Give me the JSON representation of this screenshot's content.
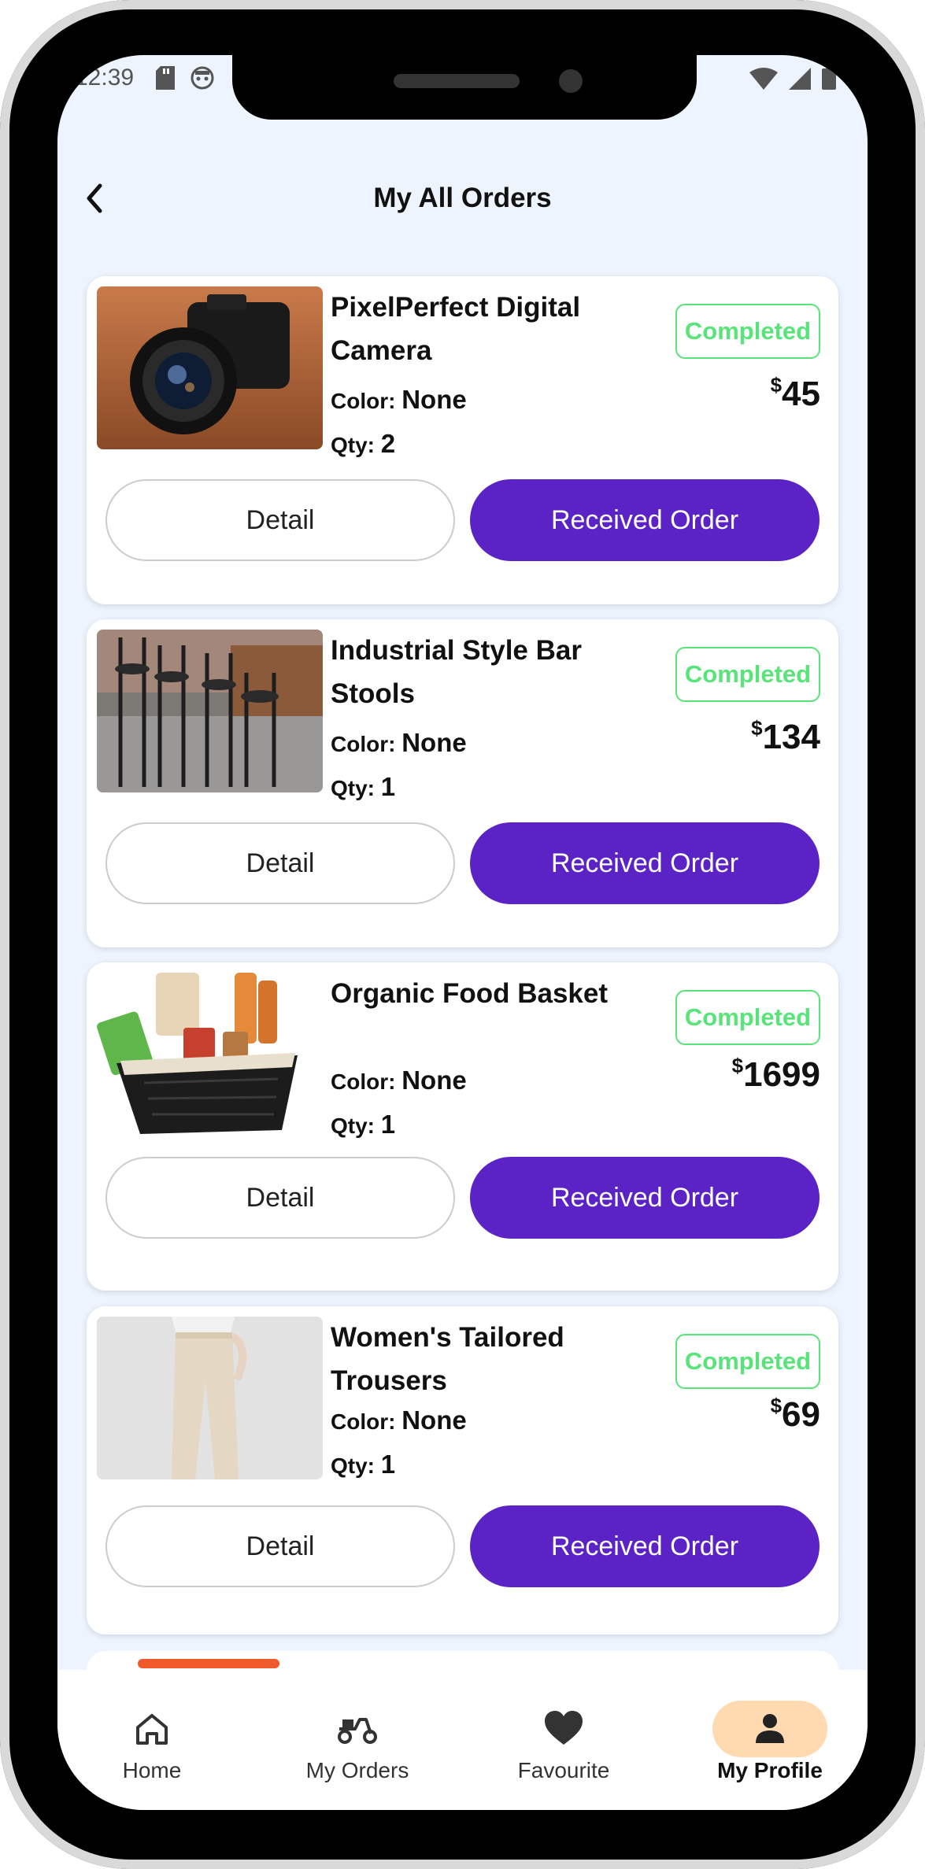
{
  "status_bar": {
    "time": "12:39"
  },
  "header": {
    "title": "My All Orders"
  },
  "labels": {
    "color": "Color:",
    "qty": "Qty:",
    "currency": "$",
    "detail_button": "Detail",
    "received_button": "Received Order"
  },
  "orders": [
    {
      "name": "PixelPerfect Digital Camera",
      "color": "None",
      "qty": "2",
      "status": "Completed",
      "price": "45"
    },
    {
      "name": "Industrial Style Bar Stools",
      "color": "None",
      "qty": "1",
      "status": "Completed",
      "price": "134"
    },
    {
      "name": "Organic Food Basket",
      "color": "None",
      "qty": "1",
      "status": "Completed",
      "price": "1699"
    },
    {
      "name": "Women's Tailored Trousers",
      "color": "None",
      "qty": "1",
      "status": "Completed",
      "price": "69"
    }
  ],
  "bottom_nav": {
    "items": [
      {
        "label": "Home",
        "icon": "home-icon"
      },
      {
        "label": "My Orders",
        "icon": "scooter-icon"
      },
      {
        "label": "Favourite",
        "icon": "heart-icon"
      },
      {
        "label": "My Profile",
        "icon": "person-icon",
        "active": true
      }
    ]
  },
  "colors": {
    "accent": "#5b23c5",
    "status_completed": "#58e478",
    "screen_bg": "#edf4fe",
    "active_nav_bg": "#ffdab0"
  }
}
